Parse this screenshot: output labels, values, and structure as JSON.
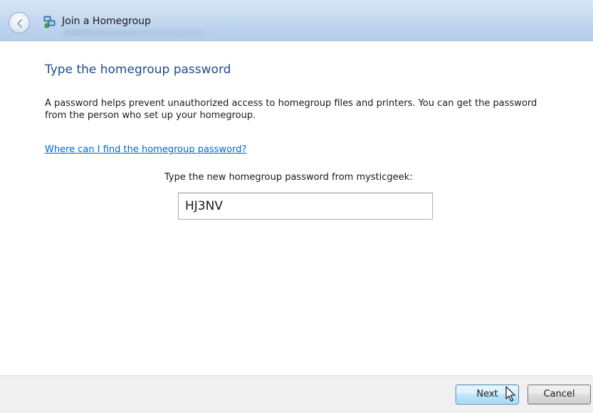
{
  "window": {
    "title": "Join a Homegroup"
  },
  "main": {
    "heading": "Type the homegroup password",
    "description": "A password helps prevent unauthorized access to homegroup files and printers. You can get the password from the person who set up your homegroup.",
    "help_link": "Where can I find the homegroup password?",
    "prompt_label": "Type the new homegroup password from mysticgeek:",
    "password_value": "HJ3NV"
  },
  "footer": {
    "next_label": "Next",
    "cancel_label": "Cancel"
  },
  "icons": {
    "back": "back-arrow-icon",
    "homegroup": "homegroup-icon",
    "cursor": "mouse-pointer-icon"
  },
  "colors": {
    "heading": "#1e4e8c",
    "link": "#0066cc",
    "footer_bg": "#f0f0f0"
  }
}
